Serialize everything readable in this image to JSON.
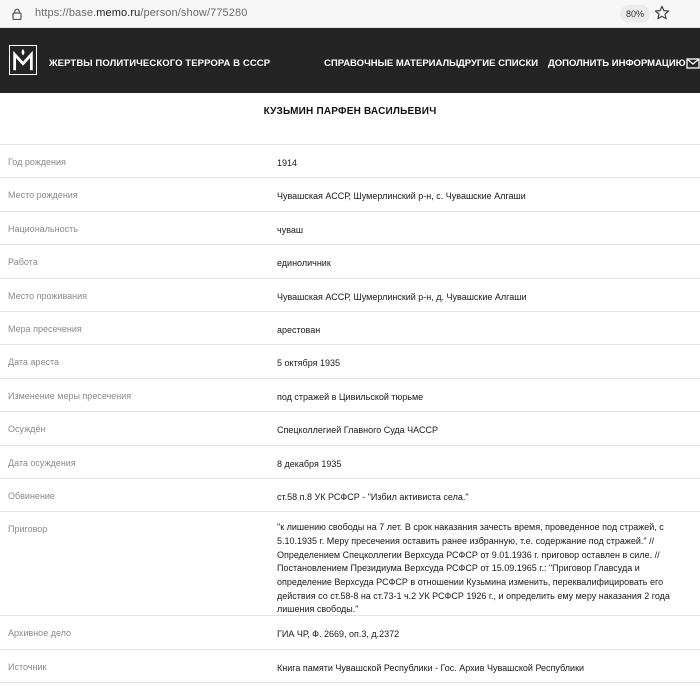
{
  "browser": {
    "url_prefix": "https://base.",
    "url_domain": "memo.ru",
    "url_path": "/person/show/775280",
    "zoom": "80%"
  },
  "header": {
    "title": "ЖЕРТВЫ ПОЛИТИЧЕСКОГО ТЕРРОРА В СССР",
    "nav": [
      {
        "label": "СПРАВОЧНЫЕ МАТЕРИАЛЫ"
      },
      {
        "label": "ДРУГИЕ СПИСКИ"
      },
      {
        "label": "ДОПОЛНИТЬ ИНФОРМАЦИЮ"
      }
    ]
  },
  "person": {
    "name": "КУЗЬМИН ПАРФЕН ВАСИЛЬЕВИЧ",
    "fields": [
      {
        "label": "Год рождения",
        "value": "1914"
      },
      {
        "label": "Место рождения",
        "value": "Чувашская АССР, Шумерлинский р-н, с. Чувашские Алгаши"
      },
      {
        "label": "Национальность",
        "value": "чуваш"
      },
      {
        "label": "Работа",
        "value": "единоличник"
      },
      {
        "label": "Место проживания",
        "value": "Чувашская АССР, Шумерлинский р-н, д. Чувашские Алгаши"
      },
      {
        "label": "Мера пресечения",
        "value": "арестован"
      },
      {
        "label": "Дата ареста",
        "value": "5 октября 1935"
      },
      {
        "label": "Изменение меры пресечения",
        "value": "под стражей в Цивильской тюрьме"
      },
      {
        "label": "Осуждён",
        "value": "Спецколлегией Главного Суда ЧАССР"
      },
      {
        "label": "Дата осуждения",
        "value": "8 декабря 1935"
      },
      {
        "label": "Обвинение",
        "value": "ст.58 п.8 УК РСФСР - \"Избил активиста села.\""
      },
      {
        "label": "Приговор",
        "value": "\"к лишению свободы на 7 лет. В срок наказания зачесть время, проведенное под стражей, с 5.10.1935 г. Меру пресечения оставить ранее избранную, т.е. содержание под стражей.\" // Определением Спецколлегии Верхсуда РСФСР от 9.01.1936 г. приговор оставлен в силе. // Постановлением Президиума Верхсуда РСФСР от 15.09.1965 г.: \"Приговор Главсуда и определение Верхсуда РСФСР в отношении Кузьмина изменить, переквалифицировать его действия со ст.58-8 на ст.73-1 ч.2 УК РСФСР 1926 г., и определить ему меру наказания 2 года лишения свободы.\""
      },
      {
        "label": "Архивное дело",
        "value": "ГИА ЧР, Ф. 2669, оп.3, д.2372"
      },
      {
        "label": "Источник",
        "value": "Книга памяти Чувашской Республики - Гос. Архив Чувашской Республики"
      }
    ]
  }
}
